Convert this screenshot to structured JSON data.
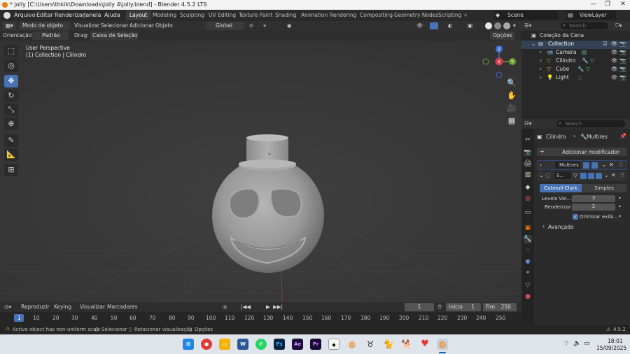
{
  "window": {
    "title": "* jolly [C:\\Users\\thkik\\Downloads\\Jolly 4\\jolly.blend] - Blender 4.5.2 LTS",
    "minimize": "—",
    "maximize": "❐",
    "close": "✕"
  },
  "menu": {
    "items": [
      "Arquivo",
      "Editar",
      "Renderizar",
      "Janela",
      "Ajuda"
    ],
    "workspaces": [
      "Layout",
      "Modeling",
      "Sculpting",
      "UV Editing",
      "Texture Paint",
      "Shading",
      "Animation",
      "Rendering",
      "Compositing",
      "Geometry Nodes",
      "Scripting"
    ],
    "add_tab": "+",
    "scene": "Scene",
    "view_layer": "ViewLayer"
  },
  "viewport_header": {
    "mode": "Modo de objeto",
    "menus": [
      "Visualizar",
      "Selecionar",
      "Adicionar",
      "Objeto"
    ],
    "transform": "Global",
    "orientation_label": "Orientação:",
    "orientation_value": "Padrão",
    "drag_label": "Drag:",
    "drag_value": "Caixa de Seleção",
    "options": "Opções"
  },
  "viewport": {
    "perspective": "User Perspective",
    "collection_info": "(1) Collection | Cilindro",
    "gizmo": {
      "x": "X",
      "y": "Y",
      "z": "Z"
    }
  },
  "outliner": {
    "search_placeholder": "Search",
    "root": "Coleção da Cena",
    "collection": "Collection",
    "objects": [
      "Camera",
      "Cilindro",
      "Cube",
      "Light"
    ]
  },
  "properties": {
    "search_placeholder": "Search",
    "breadcrumb_object": "Cilindro",
    "breadcrumb_sep": "›",
    "breadcrumb_modifier": "Multires",
    "add_modifier": "Adicionar modificador",
    "modifier1_name": "Multires",
    "modifier2_name": "S...",
    "subdiv_types": [
      "Catmull-Clark",
      "Simples"
    ],
    "levels_viewport_label": "Levels Vie...",
    "levels_viewport_value": "3",
    "render_label": "Renderizar",
    "render_value": "2",
    "optimal_display": "Otimizar exibi...",
    "advanced": "Avançado",
    "version": "4.5.2"
  },
  "timeline": {
    "menus": [
      "Reproduzir",
      "Keying",
      "Visualizar",
      "Marcadores"
    ],
    "current_frame": "1",
    "start_label": "Início",
    "start_value": "1",
    "end_label": "Fim",
    "end_value": "250",
    "ruler": [
      "1",
      "10",
      "20",
      "30",
      "40",
      "50",
      "60",
      "70",
      "80",
      "90",
      "100",
      "110",
      "120",
      "130",
      "140",
      "150",
      "160",
      "170",
      "180",
      "190",
      "200",
      "210",
      "220",
      "230",
      "240",
      "250"
    ]
  },
  "status": {
    "warning": "Active object has non-uniform scale",
    "select": "Selecionar",
    "rotate": "Rotacionar visualização",
    "options": "Opções"
  },
  "taskbar": {
    "time": "18:01",
    "date": "15/09/2025",
    "apps": [
      "windows-start",
      "chrome",
      "file-explorer",
      "word",
      "whatsapp",
      "photoshop",
      "after-effects",
      "premiere",
      "inkscape",
      "blender",
      "app-horns",
      "app-cat",
      "app-dog",
      "app-heart",
      "blender-active"
    ],
    "colors": {
      "accent": "#4772b3",
      "blender_orange": "#e87d0d"
    }
  }
}
